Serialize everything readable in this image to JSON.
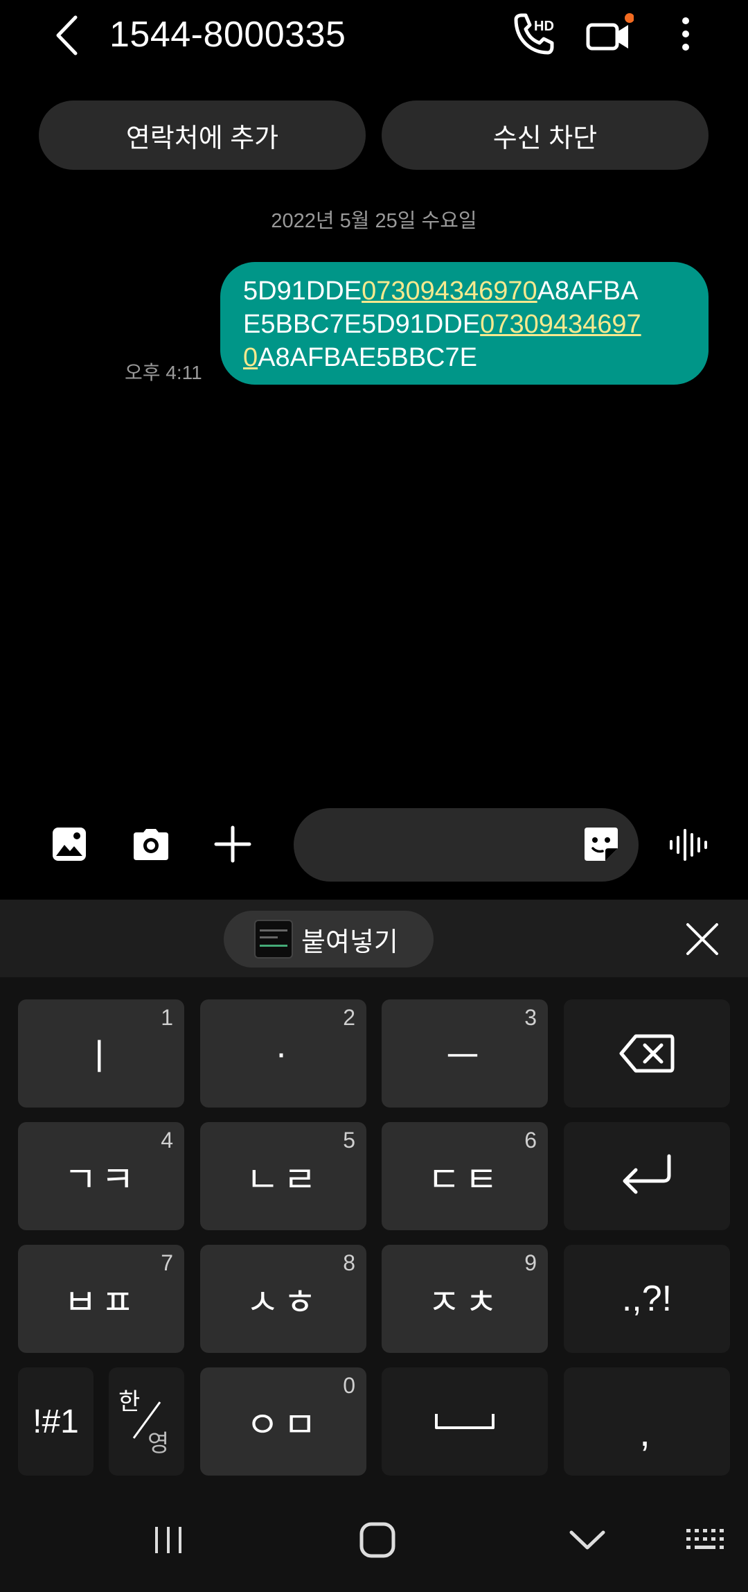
{
  "header": {
    "title": "1544-8000335",
    "hd_badge": "HD"
  },
  "actions": {
    "add_contact": "연락처에 추가",
    "block": "수신 차단"
  },
  "date_divider": "2022년 5월 25일 수요일",
  "message": {
    "time": "오후 4:11",
    "line1": {
      "a": "5D91DDE",
      "b": "073094346970",
      "c": "A8AFBA"
    },
    "line2": {
      "a": "E5BBC7E5D91DDE",
      "b": "07309434697"
    },
    "line3": {
      "a": "0",
      "b": "A8AFBAE5BBC7E"
    },
    "bubble_color": "#009688",
    "link_color": "#f7e98e"
  },
  "keyboard": {
    "paste_label": "붙여넣기",
    "keys": {
      "k1": {
        "label": "ㅣ",
        "num": "1"
      },
      "k2": {
        "label": "·",
        "num": "2"
      },
      "k3": {
        "label": "ㅡ",
        "num": "3"
      },
      "k4": {
        "label": "ㄱㅋ",
        "num": "4"
      },
      "k5": {
        "label": "ㄴㄹ",
        "num": "5"
      },
      "k6": {
        "label": "ㄷㅌ",
        "num": "6"
      },
      "k7": {
        "label": "ㅂㅍ",
        "num": "7"
      },
      "k8": {
        "label": "ㅅㅎ",
        "num": "8"
      },
      "k9": {
        "label": "ㅈㅊ",
        "num": "9"
      },
      "k0": {
        "label": "ㅇㅁ",
        "num": "0"
      },
      "punct": ".,?!",
      "symbols": "!#1",
      "lang_top": "한",
      "lang_bottom": "영",
      "comma": ","
    }
  }
}
